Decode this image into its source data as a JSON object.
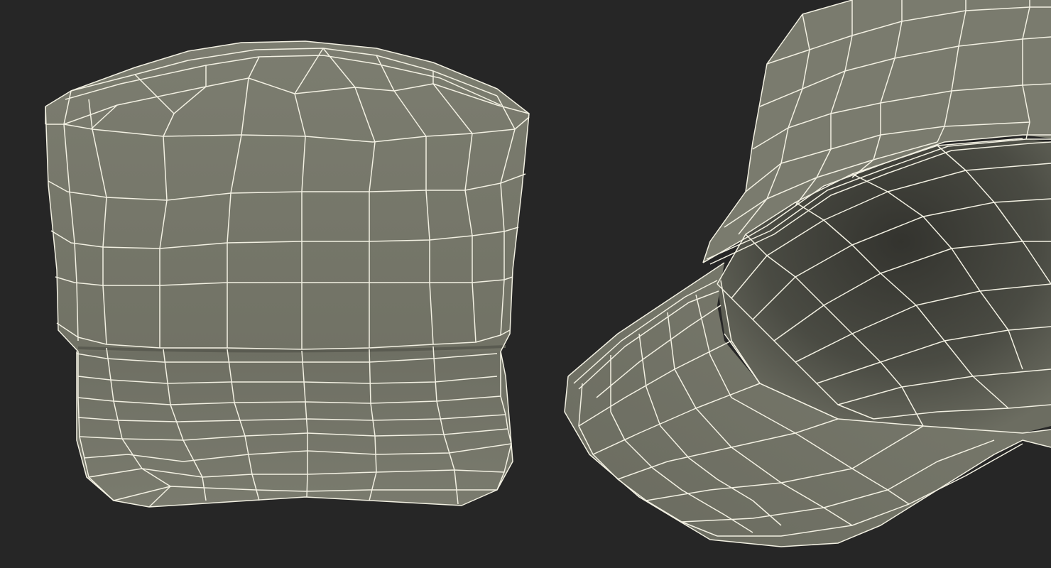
{
  "colors": {
    "background": "#262626",
    "mesh_fill": "#797a6d",
    "mesh_fill_dark": "#5f6057",
    "inner_shadow": "#3a3a34",
    "wire": "#f2f0e2"
  },
  "views": [
    {
      "id": "front-view",
      "subject": "cap-mesh-front"
    },
    {
      "id": "underside-view",
      "subject": "cap-mesh-underside"
    }
  ]
}
